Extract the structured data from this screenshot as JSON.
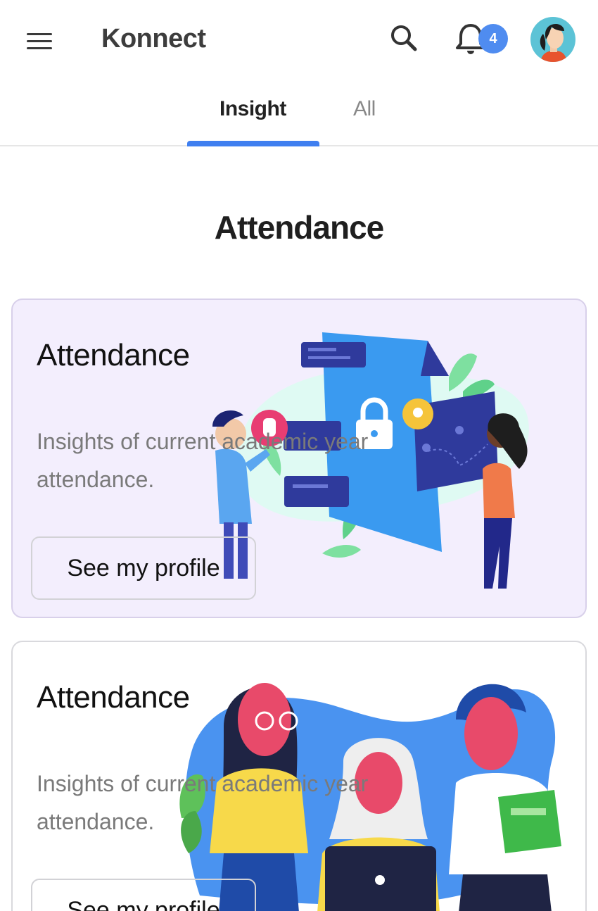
{
  "app": {
    "title": "Konnect"
  },
  "header": {
    "notification_count": "4"
  },
  "tabs": [
    {
      "label": "Insight",
      "active": true
    },
    {
      "label": "All",
      "active": false
    }
  ],
  "section": {
    "title": "Attendance"
  },
  "cards": [
    {
      "title": "Attendance",
      "description": "Insights of current academic year attendance.",
      "button_label": "See my profile",
      "illustration": "attendance-illustration"
    },
    {
      "title": "Attendance",
      "description": "Insights of current academic year attendance.",
      "button_label": "See my profile",
      "illustration": "team-illustration"
    }
  ],
  "colors": {
    "accent": "#3f7ff0",
    "badge": "#4f8cf0",
    "card_bg": "#f3eefd"
  }
}
